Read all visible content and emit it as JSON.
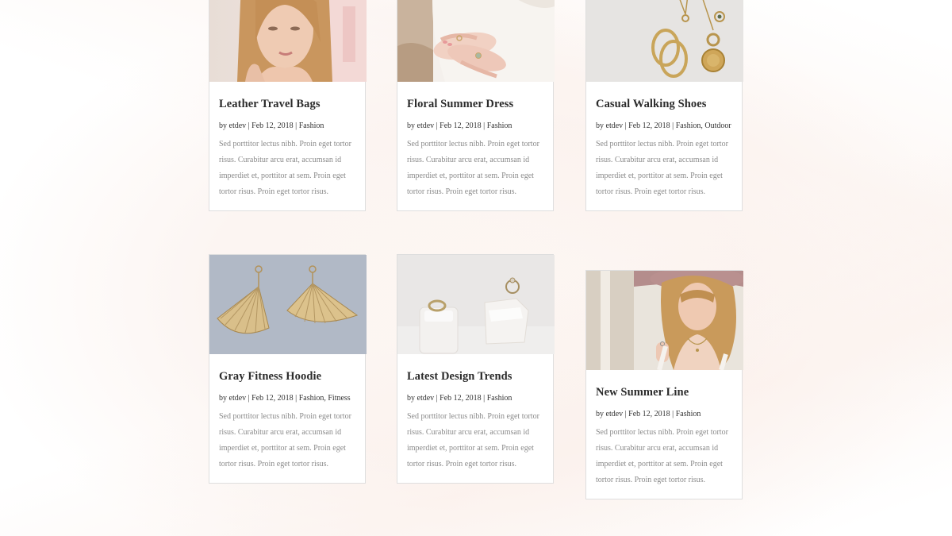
{
  "posts": [
    {
      "title": "Leather Travel Bags",
      "author": "etdev",
      "date": "Feb 12, 2018",
      "categories": "Fashion",
      "excerpt": "Sed porttitor lectus nibh. Proin eget tortor risus. Curabitur arcu erat, accumsan id imperdiet et, porttitor at sem. Proin eget tortor risus. Proin eget tortor risus.",
      "image": "woman-portrait-photo"
    },
    {
      "title": "Floral Summer Dress",
      "author": "etdev",
      "date": "Feb 12, 2018",
      "categories": "Fashion",
      "excerpt": "Sed porttitor lectus nibh. Proin eget tortor risus. Curabitur arcu erat, accumsan id imperdiet et, porttitor at sem. Proin eget tortor risus. Proin eget tortor risus.",
      "image": "hands-rings-photo"
    },
    {
      "title": "Casual Walking Shoes",
      "author": "etdev",
      "date": "Feb 12, 2018",
      "categories": "Fashion, Outdoor",
      "excerpt": "Sed porttitor lectus nibh. Proin eget tortor risus. Curabitur arcu erat, accumsan id imperdiet et, porttitor at sem. Proin eget tortor risus. Proin eget tortor risus.",
      "image": "gold-jewelry-photo"
    },
    {
      "title": "Gray Fitness Hoodie",
      "author": "etdev",
      "date": "Feb 12, 2018",
      "categories": "Fashion, Fitness",
      "excerpt": "Sed porttitor lectus nibh. Proin eget tortor risus. Curabitur arcu erat, accumsan id imperdiet et, porttitor at sem. Proin eget tortor risus. Proin eget tortor risus.",
      "image": "fan-earrings-photo"
    },
    {
      "title": "Latest Design Trends",
      "author": "etdev",
      "date": "Feb 12, 2018",
      "categories": "Fashion",
      "excerpt": "Sed porttitor lectus nibh. Proin eget tortor risus. Curabitur arcu erat, accumsan id imperdiet et, porttitor at sem. Proin eget tortor risus. Proin eget tortor risus.",
      "image": "rings-on-stands-photo"
    },
    {
      "title": "New Summer Line",
      "author": "etdev",
      "date": "Feb 12, 2018",
      "categories": "Fashion",
      "excerpt": "Sed porttitor lectus nibh. Proin eget tortor risus. Curabitur arcu erat, accumsan id imperdiet et, porttitor at sem. Proin eget tortor risus. Proin eget tortor risus.",
      "image": "woman-hat-photo"
    }
  ],
  "meta_prefix": "by",
  "meta_separator": "|",
  "colors": {
    "title": "#2b2b2b",
    "meta": "#333333",
    "excerpt": "#8a8a8a",
    "card_border": "#dedede",
    "background_tint": "#fcf5f2"
  }
}
